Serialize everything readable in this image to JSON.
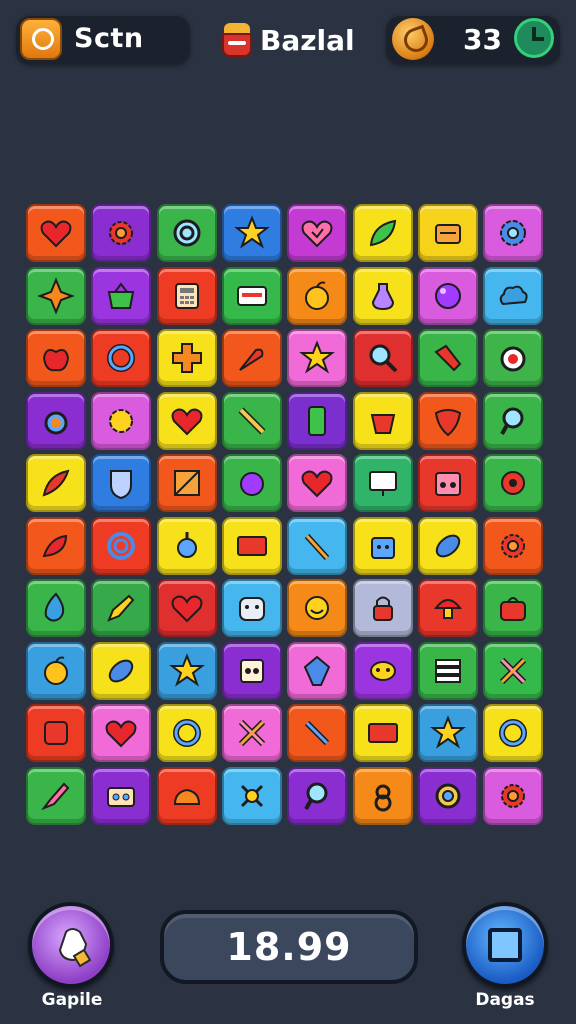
{
  "header": {
    "left_label": "Sctn",
    "title": "Bazlal",
    "coins": "33"
  },
  "footer": {
    "left_button_label": "Gapile",
    "right_button_label": "Dagas",
    "score": "18.99"
  },
  "board": {
    "rows": 10,
    "cols": 8,
    "tiles": [
      [
        "#f2581c",
        "#8a2ed1",
        "#39b54a",
        "#2f7de1",
        "#c43bd4",
        "#f7e11b",
        "#f7d21a",
        "#d95bde"
      ],
      [
        "#39b54a",
        "#9a35e0",
        "#ee3b23",
        "#36b94b",
        "#f58a19",
        "#f7e11b",
        "#d95bde",
        "#45b7ee"
      ],
      [
        "#f2581c",
        "#ee3b23",
        "#f7e11b",
        "#f2581c",
        "#f06ad8",
        "#e02f2f",
        "#39b54a",
        "#3fb44a"
      ],
      [
        "#8a2ed1",
        "#d95bde",
        "#f7e11b",
        "#39b54a",
        "#7b2fcf",
        "#f7e11b",
        "#f2581c",
        "#39b54a"
      ],
      [
        "#f7e11b",
        "#2f7de1",
        "#f2581c",
        "#39b54a",
        "#f06ad8",
        "#2fb46a",
        "#e8372b",
        "#39b54a"
      ],
      [
        "#f2581c",
        "#ee3b23",
        "#f7e11b",
        "#f7e11b",
        "#45b7ee",
        "#f7e11b",
        "#f7e11b",
        "#f2581c"
      ],
      [
        "#39b54a",
        "#36a94a",
        "#e02f2f",
        "#45b7ee",
        "#f58a19",
        "#b3b9d9",
        "#e8372b",
        "#39b54a"
      ],
      [
        "#3a9fde",
        "#f7e11b",
        "#3a9fde",
        "#8a2ed1",
        "#f06ad8",
        "#9a35e0",
        "#39b54a",
        "#36b94b"
      ],
      [
        "#ee3b23",
        "#f06ad8",
        "#f7e11b",
        "#f06ad8",
        "#f2581c",
        "#f7e11b",
        "#3a9fde",
        "#f7e11b"
      ],
      [
        "#39b54a",
        "#8a2ed1",
        "#ee3b23",
        "#45b7ee",
        "#8a2ed1",
        "#f58a19",
        "#8a2ed1",
        "#d95bde"
      ]
    ],
    "icons": [
      [
        "heart",
        "gear",
        "q-ring",
        "star",
        "heart-face",
        "leaf",
        "chest",
        "flower"
      ],
      [
        "star4",
        "basket",
        "calculator",
        "card",
        "fruit",
        "potion",
        "orb",
        "cloud"
      ],
      [
        "apple",
        "ring",
        "cross",
        "carrot",
        "star",
        "magnifier",
        "tool",
        "clock"
      ],
      [
        "ring-bell",
        "sun",
        "heart",
        "stick",
        "phone",
        "bucket",
        "bird",
        "search"
      ],
      [
        "feather",
        "shield",
        "box-x",
        "blob",
        "heart",
        "monitor",
        "radio",
        "donut"
      ],
      [
        "pepper",
        "swirl",
        "robot-round",
        "rect",
        "bat",
        "robot",
        "leaf-oval",
        "gear"
      ],
      [
        "drop",
        "pencil",
        "heart",
        "face",
        "smile",
        "lock",
        "mushroom",
        "bag"
      ],
      [
        "fruit",
        "leaf-oval",
        "star",
        "face-box",
        "gem",
        "bug",
        "stack",
        "x-tool"
      ],
      [
        "square",
        "heart",
        "ring",
        "x-tool",
        "wrench",
        "rect",
        "star",
        "ring"
      ],
      [
        "brush",
        "box-eyes",
        "cake",
        "fork",
        "search",
        "shield-8",
        "eye",
        "gear"
      ]
    ]
  }
}
